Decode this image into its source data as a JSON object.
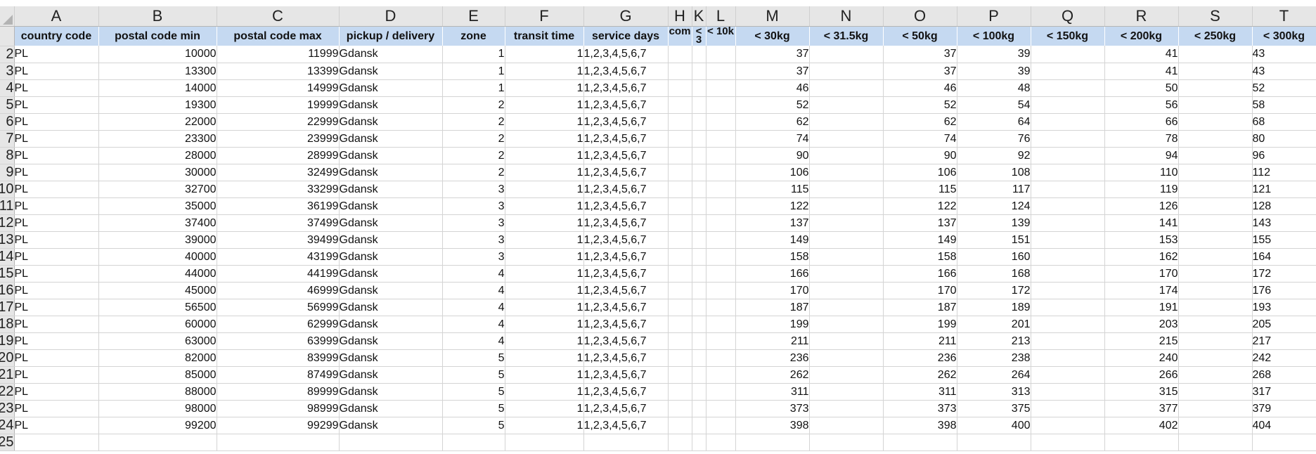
{
  "columns": [
    "A",
    "B",
    "C",
    "D",
    "E",
    "F",
    "G",
    "H",
    "K",
    "L",
    "M",
    "N",
    "O",
    "P",
    "Q",
    "R",
    "S",
    "T"
  ],
  "headers": [
    "country code",
    "postal code min",
    "postal code max",
    "pickup / delivery",
    "zone",
    "transit time",
    "service days",
    "com",
    "< 3",
    "< 10k",
    "< 30kg",
    "< 31.5kg",
    "< 50kg",
    "< 100kg",
    "< 150kg",
    "< 200kg",
    "< 250kg",
    "< 300kg"
  ],
  "row_numbers": [
    "2",
    "3",
    "4",
    "5",
    "6",
    "7",
    "8",
    "9",
    "10",
    "11",
    "12",
    "13",
    "14",
    "15",
    "16",
    "17",
    "18",
    "19",
    "20",
    "21",
    "22",
    "23",
    "24",
    "25"
  ],
  "rows": [
    [
      "PL",
      "10000",
      "11999",
      "Gdansk",
      "1",
      "1",
      "1,2,3,4,5,6,7",
      "",
      "",
      "",
      "37",
      "",
      "37",
      "39",
      "",
      "41",
      "",
      "43"
    ],
    [
      "PL",
      "13300",
      "13399",
      "Gdansk",
      "1",
      "1",
      "1,2,3,4,5,6,7",
      "",
      "",
      "",
      "37",
      "",
      "37",
      "39",
      "",
      "41",
      "",
      "43"
    ],
    [
      "PL",
      "14000",
      "14999",
      "Gdansk",
      "1",
      "1",
      "1,2,3,4,5,6,7",
      "",
      "",
      "",
      "46",
      "",
      "46",
      "48",
      "",
      "50",
      "",
      "52"
    ],
    [
      "PL",
      "19300",
      "19999",
      "Gdansk",
      "2",
      "1",
      "1,2,3,4,5,6,7",
      "",
      "",
      "",
      "52",
      "",
      "52",
      "54",
      "",
      "56",
      "",
      "58"
    ],
    [
      "PL",
      "22000",
      "22999",
      "Gdansk",
      "2",
      "1",
      "1,2,3,4,5,6,7",
      "",
      "",
      "",
      "62",
      "",
      "62",
      "64",
      "",
      "66",
      "",
      "68"
    ],
    [
      "PL",
      "23300",
      "23999",
      "Gdansk",
      "2",
      "1",
      "1,2,3,4,5,6,7",
      "",
      "",
      "",
      "74",
      "",
      "74",
      "76",
      "",
      "78",
      "",
      "80"
    ],
    [
      "PL",
      "28000",
      "28999",
      "Gdansk",
      "2",
      "1",
      "1,2,3,4,5,6,7",
      "",
      "",
      "",
      "90",
      "",
      "90",
      "92",
      "",
      "94",
      "",
      "96"
    ],
    [
      "PL",
      "30000",
      "32499",
      "Gdansk",
      "2",
      "1",
      "1,2,3,4,5,6,7",
      "",
      "",
      "",
      "106",
      "",
      "106",
      "108",
      "",
      "110",
      "",
      "112"
    ],
    [
      "PL",
      "32700",
      "33299",
      "Gdansk",
      "3",
      "1",
      "1,2,3,4,5,6,7",
      "",
      "",
      "",
      "115",
      "",
      "115",
      "117",
      "",
      "119",
      "",
      "121"
    ],
    [
      "PL",
      "35000",
      "36199",
      "Gdansk",
      "3",
      "1",
      "1,2,3,4,5,6,7",
      "",
      "",
      "",
      "122",
      "",
      "122",
      "124",
      "",
      "126",
      "",
      "128"
    ],
    [
      "PL",
      "37400",
      "37499",
      "Gdansk",
      "3",
      "1",
      "1,2,3,4,5,6,7",
      "",
      "",
      "",
      "137",
      "",
      "137",
      "139",
      "",
      "141",
      "",
      "143"
    ],
    [
      "PL",
      "39000",
      "39499",
      "Gdansk",
      "3",
      "1",
      "1,2,3,4,5,6,7",
      "",
      "",
      "",
      "149",
      "",
      "149",
      "151",
      "",
      "153",
      "",
      "155"
    ],
    [
      "PL",
      "40000",
      "43199",
      "Gdansk",
      "3",
      "1",
      "1,2,3,4,5,6,7",
      "",
      "",
      "",
      "158",
      "",
      "158",
      "160",
      "",
      "162",
      "",
      "164"
    ],
    [
      "PL",
      "44000",
      "44199",
      "Gdansk",
      "4",
      "1",
      "1,2,3,4,5,6,7",
      "",
      "",
      "",
      "166",
      "",
      "166",
      "168",
      "",
      "170",
      "",
      "172"
    ],
    [
      "PL",
      "45000",
      "46999",
      "Gdansk",
      "4",
      "1",
      "1,2,3,4,5,6,7",
      "",
      "",
      "",
      "170",
      "",
      "170",
      "172",
      "",
      "174",
      "",
      "176"
    ],
    [
      "PL",
      "56500",
      "56999",
      "Gdansk",
      "4",
      "1",
      "1,2,3,4,5,6,7",
      "",
      "",
      "",
      "187",
      "",
      "187",
      "189",
      "",
      "191",
      "",
      "193"
    ],
    [
      "PL",
      "60000",
      "62999",
      "Gdansk",
      "4",
      "1",
      "1,2,3,4,5,6,7",
      "",
      "",
      "",
      "199",
      "",
      "199",
      "201",
      "",
      "203",
      "",
      "205"
    ],
    [
      "PL",
      "63000",
      "63999",
      "Gdansk",
      "4",
      "1",
      "1,2,3,4,5,6,7",
      "",
      "",
      "",
      "211",
      "",
      "211",
      "213",
      "",
      "215",
      "",
      "217"
    ],
    [
      "PL",
      "82000",
      "83999",
      "Gdansk",
      "5",
      "1",
      "1,2,3,4,5,6,7",
      "",
      "",
      "",
      "236",
      "",
      "236",
      "238",
      "",
      "240",
      "",
      "242"
    ],
    [
      "PL",
      "85000",
      "87499",
      "Gdansk",
      "5",
      "1",
      "1,2,3,4,5,6,7",
      "",
      "",
      "",
      "262",
      "",
      "262",
      "264",
      "",
      "266",
      "",
      "268"
    ],
    [
      "PL",
      "88000",
      "89999",
      "Gdansk",
      "5",
      "1",
      "1,2,3,4,5,6,7",
      "",
      "",
      "",
      "311",
      "",
      "311",
      "313",
      "",
      "315",
      "",
      "317"
    ],
    [
      "PL",
      "98000",
      "98999",
      "Gdansk",
      "5",
      "1",
      "1,2,3,4,5,6,7",
      "",
      "",
      "",
      "373",
      "",
      "373",
      "375",
      "",
      "377",
      "",
      "379"
    ],
    [
      "PL",
      "99200",
      "99299",
      "Gdansk",
      "5",
      "1",
      "1,2,3,4,5,6,7",
      "",
      "",
      "",
      "398",
      "",
      "398",
      "400",
      "",
      "402",
      "",
      "404"
    ]
  ],
  "colors": {
    "header_fill": "#c5d9f1",
    "grid_header": "#e6e6e6",
    "gridline": "#d4d4d4"
  }
}
